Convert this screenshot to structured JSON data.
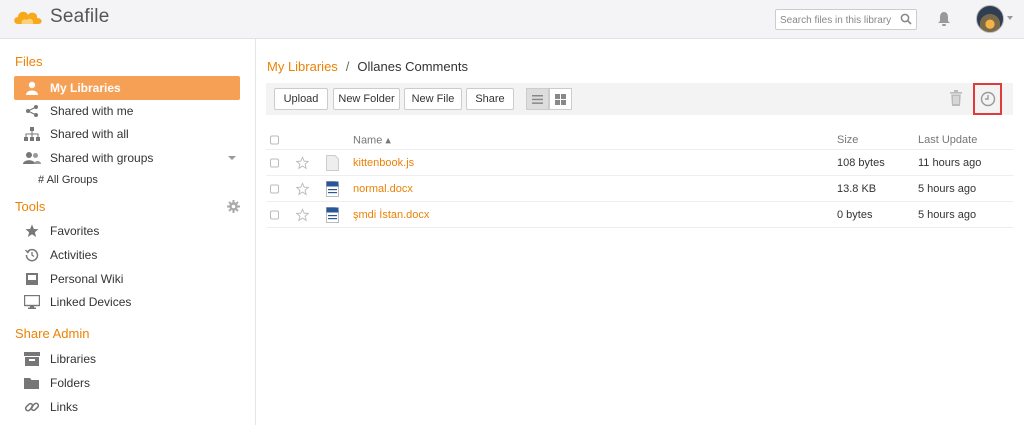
{
  "app": {
    "name": "Seafile"
  },
  "header": {
    "search_placeholder": "Search files in this library"
  },
  "sidebar": {
    "files_title": "Files",
    "files_items": [
      {
        "label": "My Libraries",
        "icon": "user-icon",
        "active": true
      },
      {
        "label": "Shared with me",
        "icon": "share-icon"
      },
      {
        "label": "Shared with all",
        "icon": "org-icon"
      },
      {
        "label": "Shared with groups",
        "icon": "group-icon"
      }
    ],
    "all_groups": "# All Groups",
    "tools_title": "Tools",
    "tools_items": [
      {
        "label": "Favorites",
        "icon": "star-icon"
      },
      {
        "label": "Activities",
        "icon": "history-icon"
      },
      {
        "label": "Personal Wiki",
        "icon": "wiki-icon"
      },
      {
        "label": "Linked Devices",
        "icon": "monitor-icon"
      }
    ],
    "share_admin_title": "Share Admin",
    "share_admin_items": [
      {
        "label": "Libraries",
        "icon": "libraries-icon"
      },
      {
        "label": "Folders",
        "icon": "folder-icon"
      },
      {
        "label": "Links",
        "icon": "link-icon"
      }
    ]
  },
  "breadcrumb": {
    "root": "My Libraries",
    "separator": "/",
    "current": "Ollanes Comments"
  },
  "toolbar": {
    "upload": "Upload",
    "new_folder": "New Folder",
    "new_file": "New File",
    "share": "Share"
  },
  "table": {
    "headers": {
      "name": "Name ▴",
      "size": "Size",
      "last_update": "Last Update"
    },
    "rows": [
      {
        "name": "kittenbook.js",
        "size": "108 bytes",
        "updated": "11 hours ago",
        "type": "file"
      },
      {
        "name": "normal.docx",
        "size": "13.8 KB",
        "updated": "5 hours ago",
        "type": "docx"
      },
      {
        "name": "şmdi İstan.docx",
        "size": "0 bytes",
        "updated": "5 hours ago",
        "type": "docx"
      }
    ]
  },
  "colors": {
    "accent": "#eb8205",
    "active_bg": "#f6a055",
    "highlight_border": "#e03a3a"
  }
}
